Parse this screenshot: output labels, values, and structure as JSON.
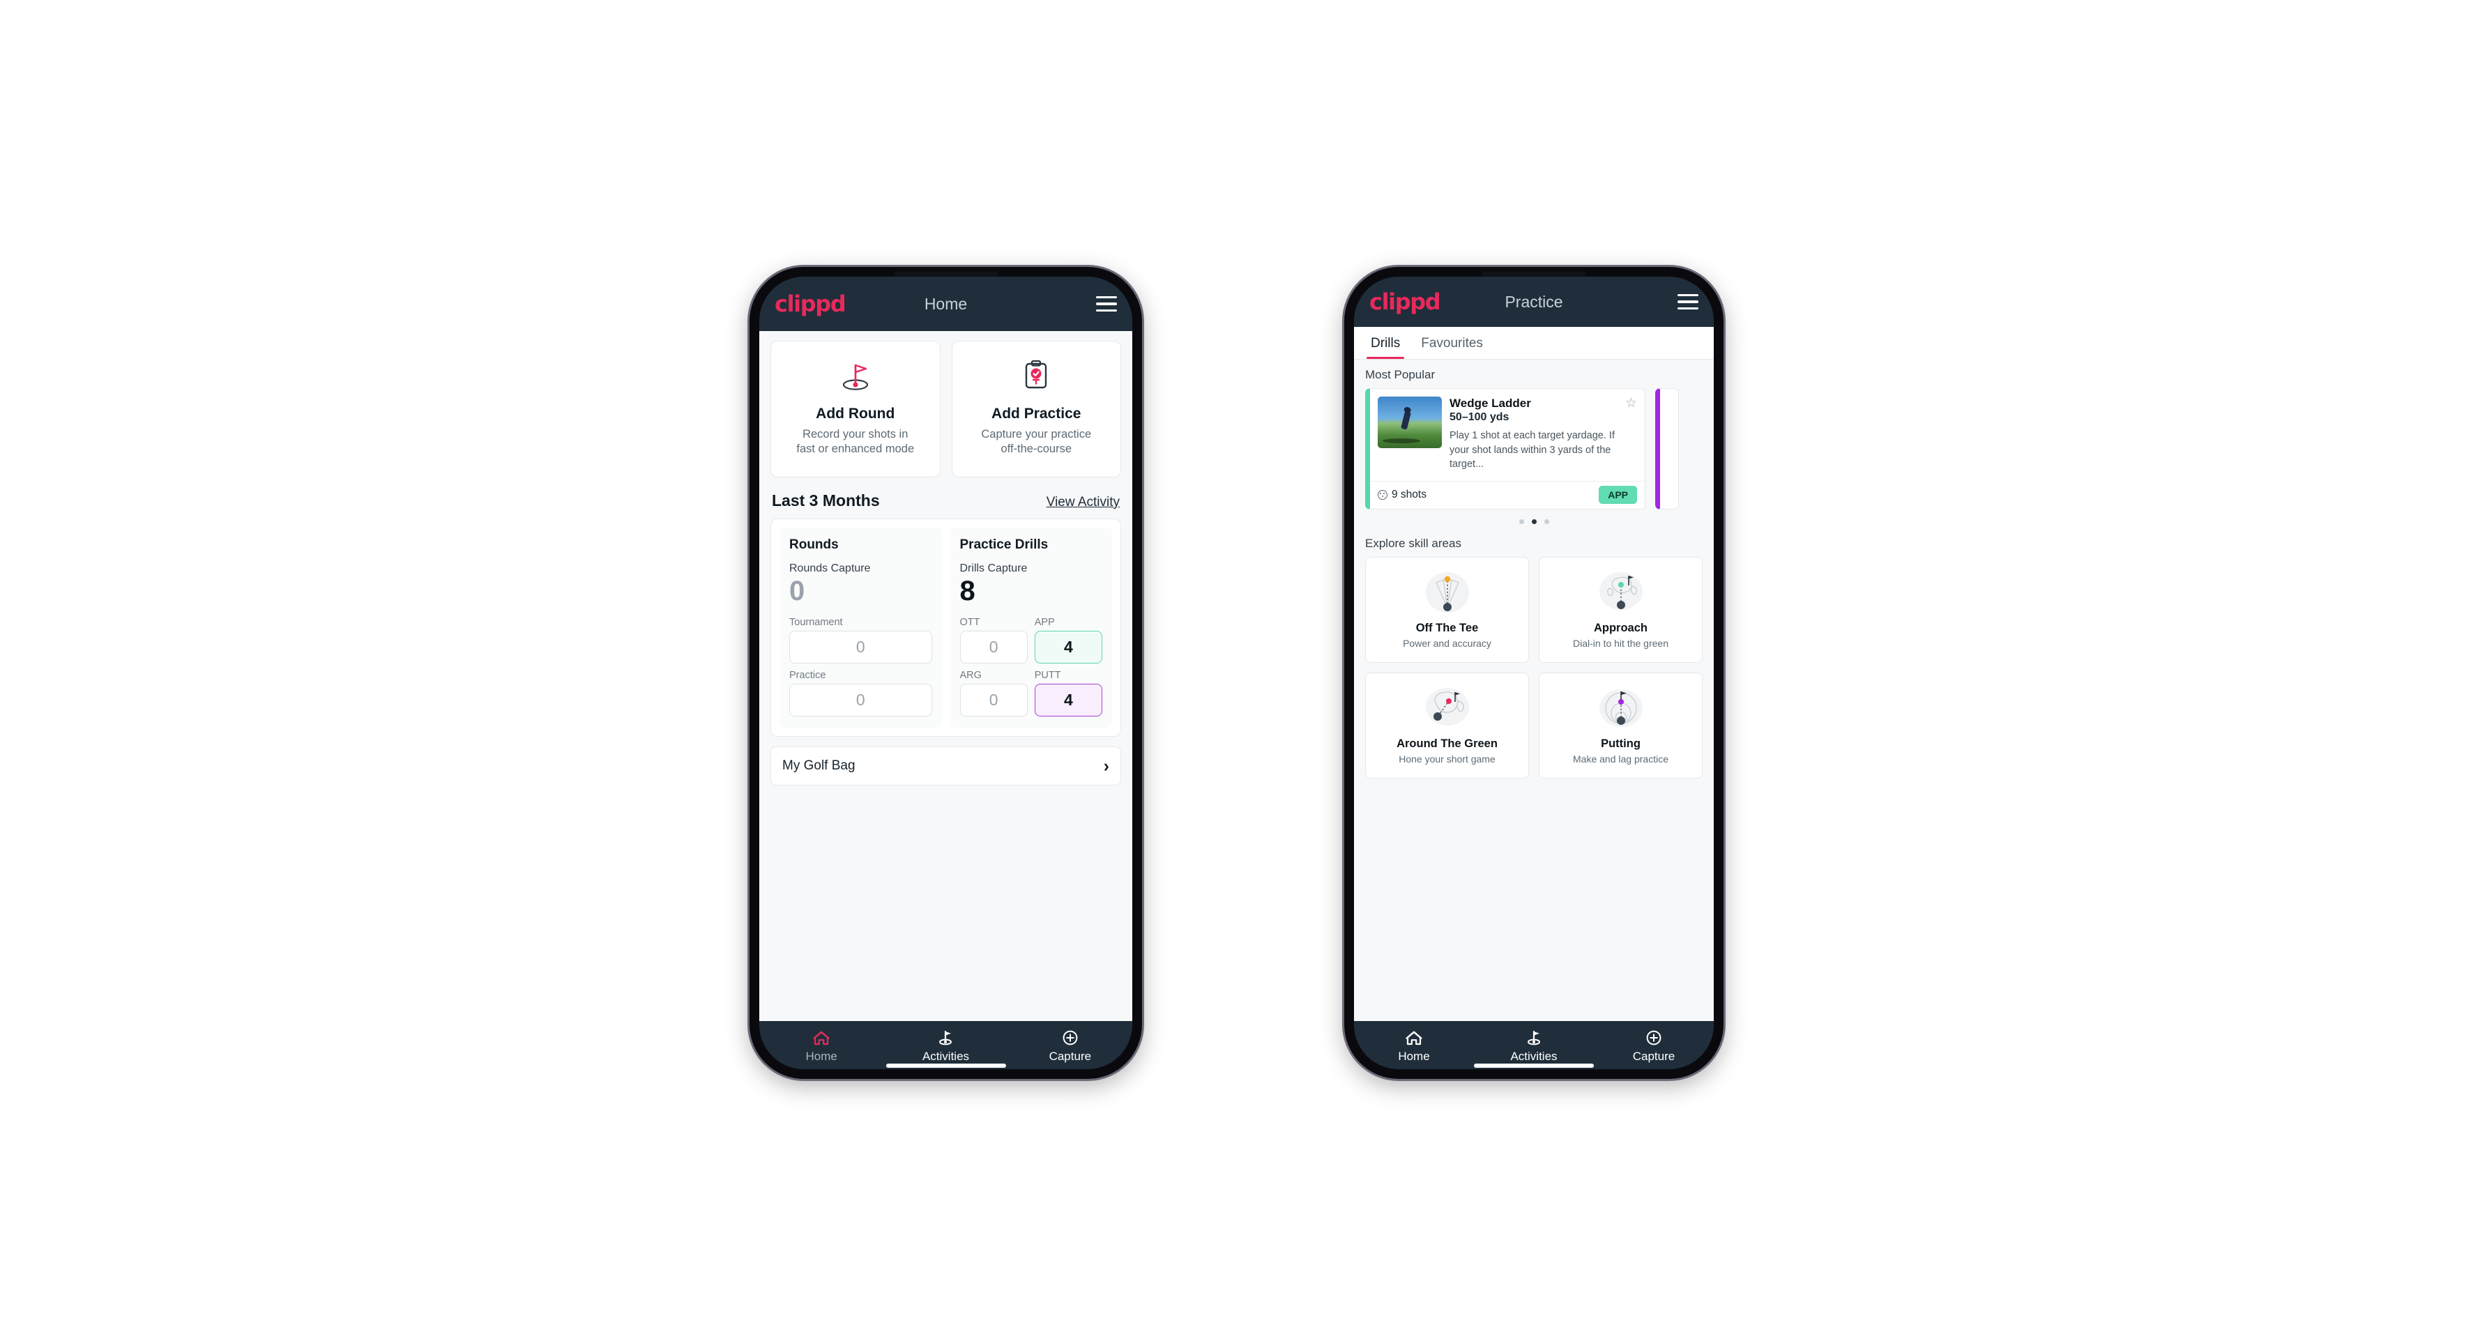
{
  "brand": "clippd",
  "phone_home": {
    "appbar": {
      "title": "Home",
      "menu_icon": "hamburger-menu-icon"
    },
    "quick_actions": [
      {
        "icon": "golf-flag-hole-icon",
        "title": "Add Round",
        "subtitle_line1": "Record your shots in",
        "subtitle_line2": "fast or enhanced mode"
      },
      {
        "icon": "clipboard-check-tee-icon",
        "title": "Add Practice",
        "subtitle_line1": "Capture your practice",
        "subtitle_line2": "off-the-course"
      }
    ],
    "section": {
      "title": "Last 3 Months",
      "link": "View Activity"
    },
    "stats": {
      "rounds": {
        "heading": "Rounds",
        "capture_label": "Rounds Capture",
        "capture_value": "0",
        "fields": [
          {
            "label": "Tournament",
            "value": "0",
            "accent": "none"
          },
          {
            "label": "Practice",
            "value": "0",
            "accent": "none"
          }
        ]
      },
      "practice_drills": {
        "heading": "Practice Drills",
        "capture_label": "Drills Capture",
        "capture_value": "8",
        "fields": [
          {
            "label": "OTT",
            "value": "0",
            "accent": "none"
          },
          {
            "label": "APP",
            "value": "4",
            "accent": "green"
          },
          {
            "label": "ARG",
            "value": "0",
            "accent": "none"
          },
          {
            "label": "PUTT",
            "value": "4",
            "accent": "purple"
          }
        ]
      }
    },
    "golf_bag": {
      "label": "My Golf Bag",
      "chevron_icon": "chevron-right-icon"
    },
    "bottom_nav": [
      {
        "label": "Home",
        "icon": "home-icon",
        "active": true
      },
      {
        "label": "Activities",
        "icon": "golf-flag-icon",
        "active": false
      },
      {
        "label": "Capture",
        "icon": "plus-circle-icon",
        "active": false
      }
    ]
  },
  "phone_practice": {
    "appbar": {
      "title": "Practice",
      "menu_icon": "hamburger-menu-icon"
    },
    "tabs": [
      {
        "label": "Drills",
        "active": true
      },
      {
        "label": "Favourites",
        "active": false
      }
    ],
    "most_popular": {
      "label": "Most Popular",
      "card": {
        "title": "Wedge Ladder",
        "yardage": "50–100 yds",
        "description": "Play 1 shot at each target yardage. If your shot lands within 3 yards of the target...",
        "shots": "9 shots",
        "badge": "APP",
        "star_icon": "star-outline-icon",
        "shots_icon": "golf-ball-icon",
        "accent_color": "#57d7ab",
        "thumbnail": "golfer-chipping-photo"
      },
      "next_card_accent": "#a227e0",
      "carousel_dots": {
        "count": 3,
        "active_index": 1
      }
    },
    "skill_areas": {
      "label": "Explore skill areas",
      "items": [
        {
          "name": "Off The Tee",
          "desc": "Power and accuracy",
          "icon": "tee-shot-fan-icon",
          "dot_color": "#f5a623"
        },
        {
          "name": "Approach",
          "desc": "Dial-in to hit the green",
          "icon": "approach-green-icon",
          "dot_color": "#57d7ab"
        },
        {
          "name": "Around The Green",
          "desc": "Hone your short game",
          "icon": "around-green-icon",
          "dot_color": "#e8295c"
        },
        {
          "name": "Putting",
          "desc": "Make and lag practice",
          "icon": "putting-rings-icon",
          "dot_color": "#a227e0"
        }
      ]
    },
    "bottom_nav": [
      {
        "label": "Home",
        "icon": "home-icon",
        "active": false
      },
      {
        "label": "Activities",
        "icon": "golf-flag-icon",
        "active": false
      },
      {
        "label": "Capture",
        "icon": "plus-circle-icon",
        "active": false
      }
    ]
  },
  "colors": {
    "brand_pink": "#e8295c",
    "appbar_dark": "#1f2e3a",
    "accent_green": "#57d7ab",
    "accent_purple": "#a227e0",
    "page_bg": "#f7f8f9"
  }
}
